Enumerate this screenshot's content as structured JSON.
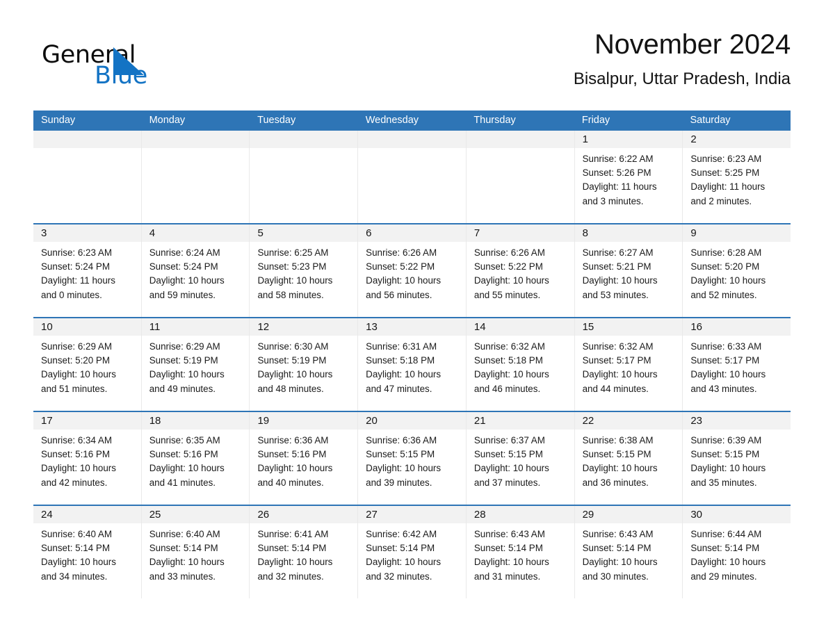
{
  "brand": {
    "name_part1": "General",
    "name_part2": "Blue",
    "triangle_icon": "triangle-right-icon",
    "accent_color": "#1373c4"
  },
  "header": {
    "title": "November 2024",
    "subtitle": "Bisalpur, Uttar Pradesh, India"
  },
  "theme": {
    "header_blue": "#2e75b6",
    "day_number_bg": "#f2f2f2",
    "cell_bg": "#ffffff"
  },
  "weekdays": [
    "Sunday",
    "Monday",
    "Tuesday",
    "Wednesday",
    "Thursday",
    "Friday",
    "Saturday"
  ],
  "weeks": [
    [
      {
        "day": "",
        "sunrise": "",
        "sunset": "",
        "daylight_line1": "",
        "daylight_line2": ""
      },
      {
        "day": "",
        "sunrise": "",
        "sunset": "",
        "daylight_line1": "",
        "daylight_line2": ""
      },
      {
        "day": "",
        "sunrise": "",
        "sunset": "",
        "daylight_line1": "",
        "daylight_line2": ""
      },
      {
        "day": "",
        "sunrise": "",
        "sunset": "",
        "daylight_line1": "",
        "daylight_line2": ""
      },
      {
        "day": "",
        "sunrise": "",
        "sunset": "",
        "daylight_line1": "",
        "daylight_line2": ""
      },
      {
        "day": "1",
        "sunrise": "Sunrise: 6:22 AM",
        "sunset": "Sunset: 5:26 PM",
        "daylight_line1": "Daylight: 11 hours",
        "daylight_line2": "and 3 minutes."
      },
      {
        "day": "2",
        "sunrise": "Sunrise: 6:23 AM",
        "sunset": "Sunset: 5:25 PM",
        "daylight_line1": "Daylight: 11 hours",
        "daylight_line2": "and 2 minutes."
      }
    ],
    [
      {
        "day": "3",
        "sunrise": "Sunrise: 6:23 AM",
        "sunset": "Sunset: 5:24 PM",
        "daylight_line1": "Daylight: 11 hours",
        "daylight_line2": "and 0 minutes."
      },
      {
        "day": "4",
        "sunrise": "Sunrise: 6:24 AM",
        "sunset": "Sunset: 5:24 PM",
        "daylight_line1": "Daylight: 10 hours",
        "daylight_line2": "and 59 minutes."
      },
      {
        "day": "5",
        "sunrise": "Sunrise: 6:25 AM",
        "sunset": "Sunset: 5:23 PM",
        "daylight_line1": "Daylight: 10 hours",
        "daylight_line2": "and 58 minutes."
      },
      {
        "day": "6",
        "sunrise": "Sunrise: 6:26 AM",
        "sunset": "Sunset: 5:22 PM",
        "daylight_line1": "Daylight: 10 hours",
        "daylight_line2": "and 56 minutes."
      },
      {
        "day": "7",
        "sunrise": "Sunrise: 6:26 AM",
        "sunset": "Sunset: 5:22 PM",
        "daylight_line1": "Daylight: 10 hours",
        "daylight_line2": "and 55 minutes."
      },
      {
        "day": "8",
        "sunrise": "Sunrise: 6:27 AM",
        "sunset": "Sunset: 5:21 PM",
        "daylight_line1": "Daylight: 10 hours",
        "daylight_line2": "and 53 minutes."
      },
      {
        "day": "9",
        "sunrise": "Sunrise: 6:28 AM",
        "sunset": "Sunset: 5:20 PM",
        "daylight_line1": "Daylight: 10 hours",
        "daylight_line2": "and 52 minutes."
      }
    ],
    [
      {
        "day": "10",
        "sunrise": "Sunrise: 6:29 AM",
        "sunset": "Sunset: 5:20 PM",
        "daylight_line1": "Daylight: 10 hours",
        "daylight_line2": "and 51 minutes."
      },
      {
        "day": "11",
        "sunrise": "Sunrise: 6:29 AM",
        "sunset": "Sunset: 5:19 PM",
        "daylight_line1": "Daylight: 10 hours",
        "daylight_line2": "and 49 minutes."
      },
      {
        "day": "12",
        "sunrise": "Sunrise: 6:30 AM",
        "sunset": "Sunset: 5:19 PM",
        "daylight_line1": "Daylight: 10 hours",
        "daylight_line2": "and 48 minutes."
      },
      {
        "day": "13",
        "sunrise": "Sunrise: 6:31 AM",
        "sunset": "Sunset: 5:18 PM",
        "daylight_line1": "Daylight: 10 hours",
        "daylight_line2": "and 47 minutes."
      },
      {
        "day": "14",
        "sunrise": "Sunrise: 6:32 AM",
        "sunset": "Sunset: 5:18 PM",
        "daylight_line1": "Daylight: 10 hours",
        "daylight_line2": "and 46 minutes."
      },
      {
        "day": "15",
        "sunrise": "Sunrise: 6:32 AM",
        "sunset": "Sunset: 5:17 PM",
        "daylight_line1": "Daylight: 10 hours",
        "daylight_line2": "and 44 minutes."
      },
      {
        "day": "16",
        "sunrise": "Sunrise: 6:33 AM",
        "sunset": "Sunset: 5:17 PM",
        "daylight_line1": "Daylight: 10 hours",
        "daylight_line2": "and 43 minutes."
      }
    ],
    [
      {
        "day": "17",
        "sunrise": "Sunrise: 6:34 AM",
        "sunset": "Sunset: 5:16 PM",
        "daylight_line1": "Daylight: 10 hours",
        "daylight_line2": "and 42 minutes."
      },
      {
        "day": "18",
        "sunrise": "Sunrise: 6:35 AM",
        "sunset": "Sunset: 5:16 PM",
        "daylight_line1": "Daylight: 10 hours",
        "daylight_line2": "and 41 minutes."
      },
      {
        "day": "19",
        "sunrise": "Sunrise: 6:36 AM",
        "sunset": "Sunset: 5:16 PM",
        "daylight_line1": "Daylight: 10 hours",
        "daylight_line2": "and 40 minutes."
      },
      {
        "day": "20",
        "sunrise": "Sunrise: 6:36 AM",
        "sunset": "Sunset: 5:15 PM",
        "daylight_line1": "Daylight: 10 hours",
        "daylight_line2": "and 39 minutes."
      },
      {
        "day": "21",
        "sunrise": "Sunrise: 6:37 AM",
        "sunset": "Sunset: 5:15 PM",
        "daylight_line1": "Daylight: 10 hours",
        "daylight_line2": "and 37 minutes."
      },
      {
        "day": "22",
        "sunrise": "Sunrise: 6:38 AM",
        "sunset": "Sunset: 5:15 PM",
        "daylight_line1": "Daylight: 10 hours",
        "daylight_line2": "and 36 minutes."
      },
      {
        "day": "23",
        "sunrise": "Sunrise: 6:39 AM",
        "sunset": "Sunset: 5:15 PM",
        "daylight_line1": "Daylight: 10 hours",
        "daylight_line2": "and 35 minutes."
      }
    ],
    [
      {
        "day": "24",
        "sunrise": "Sunrise: 6:40 AM",
        "sunset": "Sunset: 5:14 PM",
        "daylight_line1": "Daylight: 10 hours",
        "daylight_line2": "and 34 minutes."
      },
      {
        "day": "25",
        "sunrise": "Sunrise: 6:40 AM",
        "sunset": "Sunset: 5:14 PM",
        "daylight_line1": "Daylight: 10 hours",
        "daylight_line2": "and 33 minutes."
      },
      {
        "day": "26",
        "sunrise": "Sunrise: 6:41 AM",
        "sunset": "Sunset: 5:14 PM",
        "daylight_line1": "Daylight: 10 hours",
        "daylight_line2": "and 32 minutes."
      },
      {
        "day": "27",
        "sunrise": "Sunrise: 6:42 AM",
        "sunset": "Sunset: 5:14 PM",
        "daylight_line1": "Daylight: 10 hours",
        "daylight_line2": "and 32 minutes."
      },
      {
        "day": "28",
        "sunrise": "Sunrise: 6:43 AM",
        "sunset": "Sunset: 5:14 PM",
        "daylight_line1": "Daylight: 10 hours",
        "daylight_line2": "and 31 minutes."
      },
      {
        "day": "29",
        "sunrise": "Sunrise: 6:43 AM",
        "sunset": "Sunset: 5:14 PM",
        "daylight_line1": "Daylight: 10 hours",
        "daylight_line2": "and 30 minutes."
      },
      {
        "day": "30",
        "sunrise": "Sunrise: 6:44 AM",
        "sunset": "Sunset: 5:14 PM",
        "daylight_line1": "Daylight: 10 hours",
        "daylight_line2": "and 29 minutes."
      }
    ]
  ]
}
